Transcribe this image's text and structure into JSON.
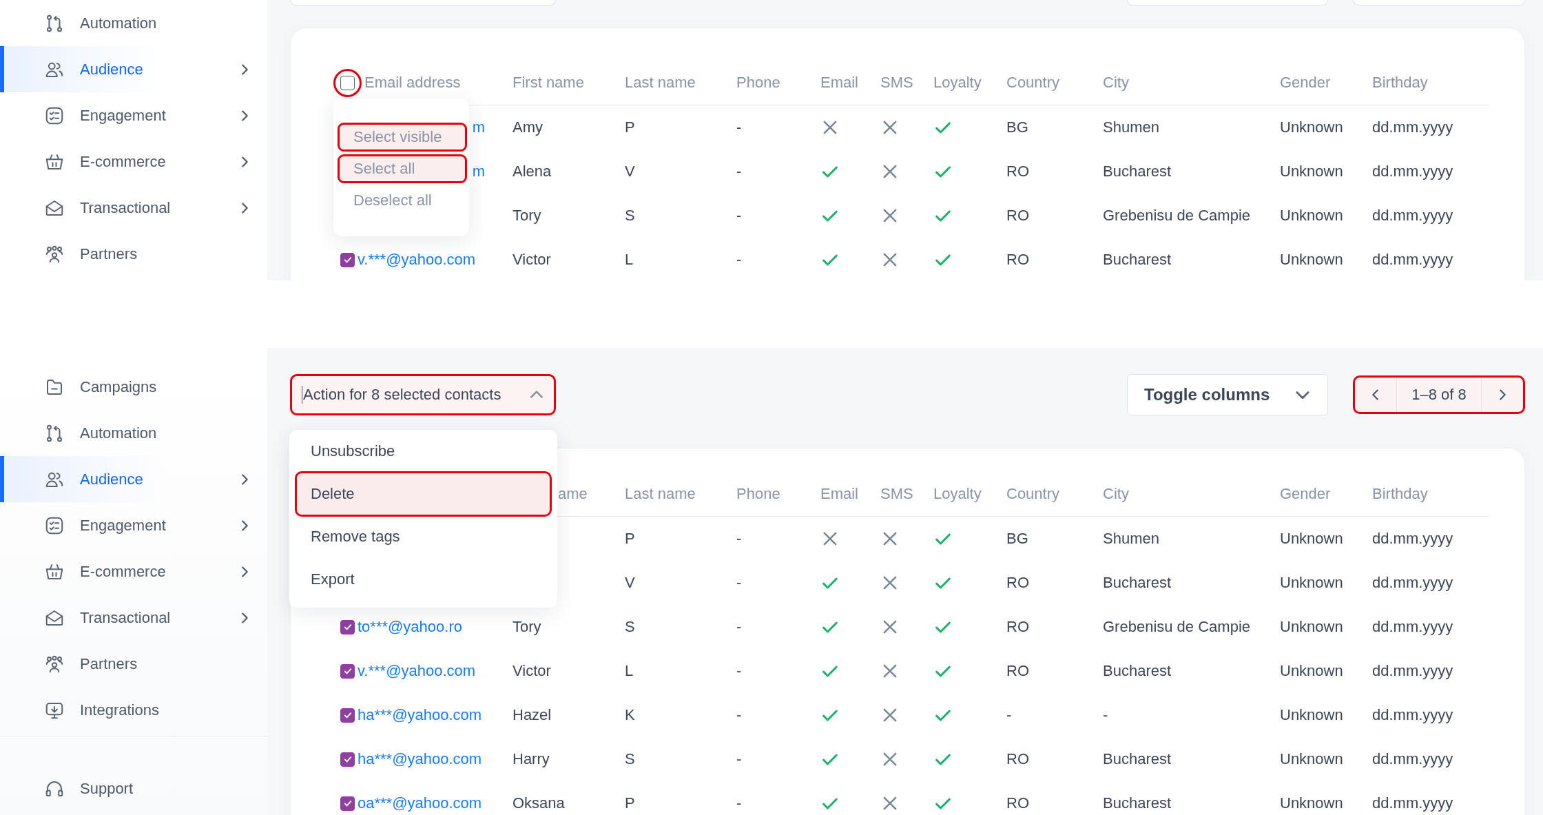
{
  "panels": [
    {
      "sidebar": {
        "items": [
          {
            "label": "Automation",
            "kind": "branch",
            "selected": false,
            "expandable": false
          },
          {
            "label": "Audience",
            "kind": "people",
            "selected": true,
            "expandable": true
          },
          {
            "label": "Engagement",
            "kind": "checklist",
            "selected": false,
            "expandable": true
          },
          {
            "label": "E-commerce",
            "kind": "basket",
            "selected": false,
            "expandable": true
          },
          {
            "label": "Transactional",
            "kind": "envelope",
            "selected": false,
            "expandable": true
          },
          {
            "label": "Partners",
            "kind": "group",
            "selected": false,
            "expandable": false
          }
        ]
      },
      "table": {
        "select_all": {
          "checked": false,
          "highlighted": true
        },
        "columns": [
          "Email address",
          "First name",
          "Last name",
          "Phone",
          "Email",
          "SMS",
          "Loyalty",
          "Country",
          "City",
          "Gender",
          "Birthday"
        ],
        "rows": [
          {
            "email": "m",
            "first_name": "Amy",
            "last_name": "P",
            "phone": "-",
            "email_ok": false,
            "sms_ok": false,
            "loyalty": true,
            "country": "BG",
            "city": "Shumen",
            "gender": "Unknown",
            "birthday": "dd.mm.yyyy"
          },
          {
            "email": "m",
            "first_name": "Alena",
            "last_name": "V",
            "phone": "-",
            "email_ok": true,
            "sms_ok": false,
            "loyalty": true,
            "country": "RO",
            "city": "Bucharest",
            "gender": "Unknown",
            "birthday": "dd.mm.yyyy"
          },
          {
            "first_name": "Tory",
            "last_name": "S",
            "phone": "-",
            "email_ok": true,
            "sms_ok": false,
            "loyalty": true,
            "country": "RO",
            "city": "Grebenisu de Campie",
            "gender": "Unknown",
            "birthday": "dd.mm.yyyy"
          },
          {
            "checked": true,
            "email": "v.***@yahoo.com",
            "first_name": "Victor",
            "last_name": "L",
            "phone": "-",
            "email_ok": true,
            "sms_ok": false,
            "loyalty": true,
            "country": "RO",
            "city": "Bucharest",
            "gender": "Unknown",
            "birthday": "dd.mm.yyyy"
          }
        ]
      },
      "select_menu": {
        "items": [
          {
            "label": "Select visible",
            "highlighted": true
          },
          {
            "label": "Select all",
            "highlighted": true
          },
          {
            "label": "Deselect all",
            "highlighted": false
          }
        ]
      }
    },
    {
      "sidebar": {
        "items": [
          {
            "label": "Campaigns",
            "kind": "folder",
            "selected": false,
            "expandable": false
          },
          {
            "label": "Automation",
            "kind": "branch",
            "selected": false,
            "expandable": false
          },
          {
            "label": "Audience",
            "kind": "people",
            "selected": true,
            "expandable": true
          },
          {
            "label": "Engagement",
            "kind": "checklist",
            "selected": false,
            "expandable": true
          },
          {
            "label": "E-commerce",
            "kind": "basket",
            "selected": false,
            "expandable": true
          },
          {
            "label": "Transactional",
            "kind": "envelope",
            "selected": false,
            "expandable": true
          },
          {
            "label": "Partners",
            "kind": "group",
            "selected": false,
            "expandable": false
          },
          {
            "label": "Integrations",
            "kind": "download",
            "selected": false,
            "expandable": false
          }
        ],
        "footer_items": [
          {
            "label": "Support",
            "kind": "headset",
            "selected": false,
            "expandable": false
          }
        ]
      },
      "toolbar": {
        "action_select": {
          "value": "Action for 8 selected contacts",
          "highlighted": true
        },
        "toggle_columns": {
          "label": "Toggle columns",
          "highlighted": false
        },
        "pagination": {
          "range": "1–8 of 8",
          "highlighted": true
        }
      },
      "table": {
        "columns": [
          "",
          "ame",
          "Last name",
          "Phone",
          "Email",
          "SMS",
          "Loyalty",
          "Country",
          "City",
          "Gender",
          "Birthday"
        ],
        "rows": [
          {
            "last_name": "P",
            "phone": "-",
            "email_ok": false,
            "sms_ok": false,
            "loyalty": true,
            "country": "BG",
            "city": "Shumen",
            "gender": "Unknown",
            "birthday": "dd.mm.yyyy"
          },
          {
            "last_name": "V",
            "phone": "-",
            "email_ok": true,
            "sms_ok": false,
            "loyalty": true,
            "country": "RO",
            "city": "Bucharest",
            "gender": "Unknown",
            "birthday": "dd.mm.yyyy"
          },
          {
            "checked": true,
            "email": "to***@yahoo.ro",
            "first_name": "Tory",
            "last_name": "S",
            "phone": "-",
            "email_ok": true,
            "sms_ok": false,
            "loyalty": true,
            "country": "RO",
            "city": "Grebenisu de Campie",
            "gender": "Unknown",
            "birthday": "dd.mm.yyyy"
          },
          {
            "checked": true,
            "email": "v.***@yahoo.com",
            "first_name": "Victor",
            "last_name": "L",
            "phone": "-",
            "email_ok": true,
            "sms_ok": false,
            "loyalty": true,
            "country": "RO",
            "city": "Bucharest",
            "gender": "Unknown",
            "birthday": "dd.mm.yyyy"
          },
          {
            "checked": true,
            "email": "ha***@yahoo.com",
            "first_name": "Hazel",
            "last_name": "K",
            "phone": "-",
            "email_ok": true,
            "sms_ok": false,
            "loyalty": true,
            "country": "-",
            "city": "-",
            "gender": "Unknown",
            "birthday": "dd.mm.yyyy"
          },
          {
            "checked": true,
            "email": "ha***@yahoo.com",
            "first_name": "Harry",
            "last_name": "S",
            "phone": "-",
            "email_ok": true,
            "sms_ok": false,
            "loyalty": true,
            "country": "RO",
            "city": "Bucharest",
            "gender": "Unknown",
            "birthday": "dd.mm.yyyy"
          },
          {
            "checked": true,
            "email": "oa***@yahoo.com",
            "first_name": "Oksana",
            "last_name": "P",
            "phone": "-",
            "email_ok": true,
            "sms_ok": false,
            "loyalty": true,
            "country": "RO",
            "city": "Bucharest",
            "gender": "Unknown",
            "birthday": "dd.mm.yyyy"
          }
        ]
      },
      "action_menu": {
        "items": [
          {
            "label": "Unsubscribe",
            "highlighted": false
          },
          {
            "label": "Delete",
            "highlighted": true
          },
          {
            "label": "Remove tags",
            "highlighted": false
          },
          {
            "label": "Export",
            "highlighted": false
          }
        ]
      }
    }
  ]
}
